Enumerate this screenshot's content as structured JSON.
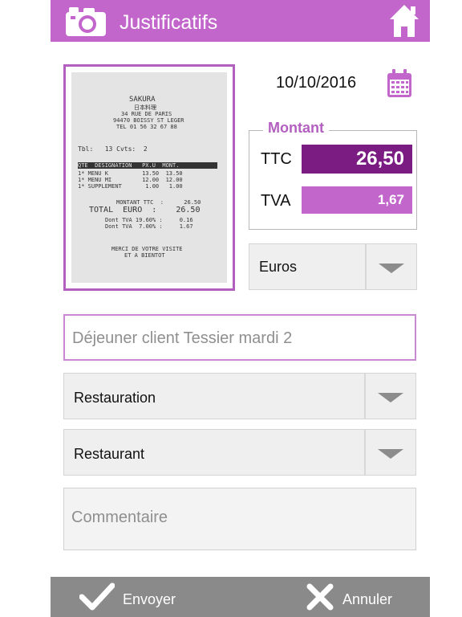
{
  "header": {
    "title": "Justificatifs",
    "camera_icon": "camera-icon",
    "home_icon": "home-icon",
    "color": "#c266cc"
  },
  "receipt": {
    "lines": [
      "SAKURA",
      "日本料理",
      "34 RUE DE PARIS",
      "94470 BOISSY ST LEGER",
      "TEL 01 56 32 67 88",
      "Tbl:   13 Cvts:  2",
      "QTE  DESIGNATION   PX.U  MONT.",
      "1* MENU K          13.50  13.50",
      "1* MENU MI         12.00  12.00",
      "1* SUPPLEMENT       1.00   1.00",
      "MONTANT TTC  :      26.50",
      "TOTAL  EURO  :    26.50",
      "Dont TVA 19.60% :     0.16",
      "Dont TVA  7.00% :     1.67",
      "MERCI DE VOTRE VISITE",
      "ET A BIENTOT"
    ]
  },
  "date": {
    "value": "10/10/2016",
    "calendar_icon": "calendar-icon"
  },
  "montant": {
    "legend": "Montant",
    "ttc_label": "TTC",
    "ttc_value": "26,50",
    "tva_label": "TVA",
    "tva_value": "1,67"
  },
  "currency": {
    "value": "Euros"
  },
  "description": {
    "value": "Déjeuner client Tessier mardi 2"
  },
  "category": {
    "value": "Restauration"
  },
  "subcategory": {
    "value": "Restaurant"
  },
  "comment": {
    "placeholder": "Commentaire"
  },
  "footer": {
    "send_label": "Envoyer",
    "cancel_label": "Annuler",
    "send_icon": "checkmark-icon",
    "cancel_icon": "close-icon"
  }
}
